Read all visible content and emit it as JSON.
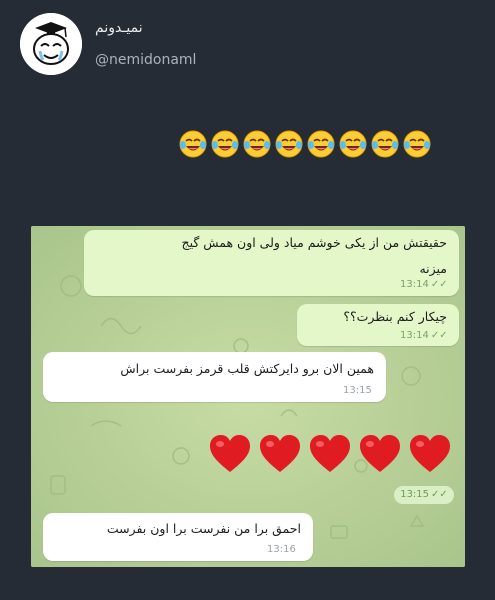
{
  "profile": {
    "display_name": "نمیـدونم",
    "handle": "@nemidonaml"
  },
  "tweet": {
    "emoji_count": 8,
    "emoji_icon": "face-with-tears-of-joy-icon"
  },
  "chat": {
    "messages": [
      {
        "direction": "out",
        "text_line1": "حقیقتش من از یکی خوشم میاد ولی اون همش گیج",
        "text_line2": "میزنه",
        "time": "13:14"
      },
      {
        "direction": "out",
        "text_line1": "چیکار کنم بنظرت؟؟",
        "time": "13:14"
      },
      {
        "direction": "in",
        "text_line1": "همین الان برو دایرکتش قلب قرمز بفرست براش",
        "time": "13:15"
      },
      {
        "direction": "out",
        "hearts": 5,
        "time": "13:15"
      },
      {
        "direction": "in",
        "text_line1": "احمق برا من نفرست برا اون بفرست",
        "time": "13:16"
      }
    ],
    "colors": {
      "outgoing_bubble": "#e3f7c8",
      "incoming_bubble": "#ffffff",
      "wallpaper": "#b7cf9a"
    }
  }
}
